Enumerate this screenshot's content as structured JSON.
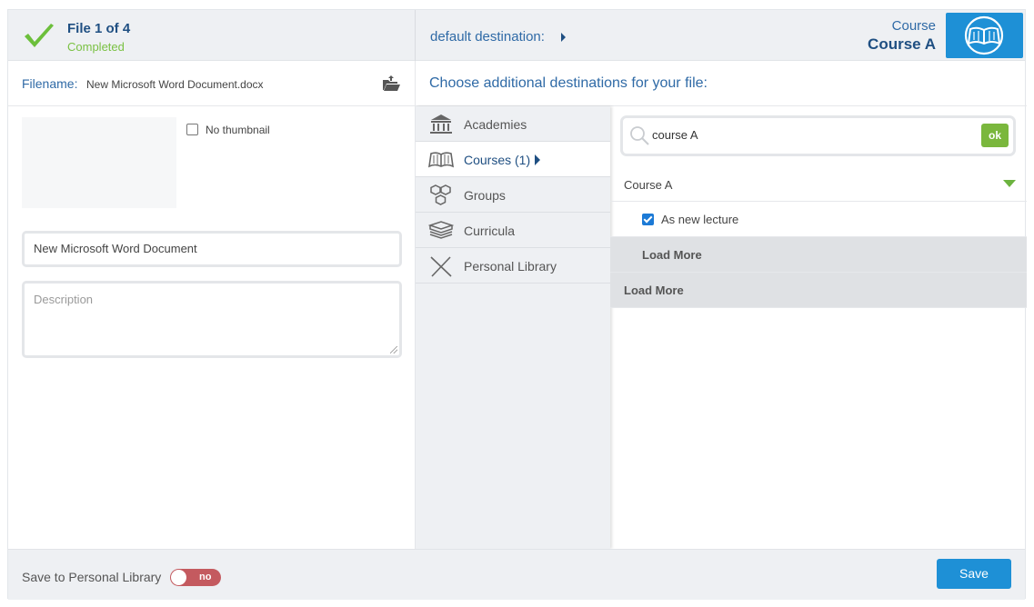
{
  "header": {
    "file_title": "File 1 of 4",
    "file_status": "Completed",
    "default_destination_label": "default destination:",
    "course_type": "Course",
    "course_name": "Course A",
    "icons": {
      "status": "checkmark-icon",
      "course": "open-book-icon"
    },
    "colors": {
      "status_green": "#7ac143",
      "accent_blue": "#1e90d6",
      "title_blue": "#1f4f82"
    }
  },
  "file": {
    "filename_label": "Filename:",
    "filename_value": "New Microsoft Word Document.docx",
    "no_thumbnail_label": "No thumbnail",
    "no_thumbnail_checked": false,
    "title_value": "New Microsoft Word Document",
    "description_placeholder": "Description"
  },
  "destinations": {
    "heading": "Choose additional destinations for your file:",
    "categories": [
      {
        "label": "Academies",
        "icon": "building-icon",
        "active": false
      },
      {
        "label": "Courses (1)",
        "icon": "book-icon",
        "active": true
      },
      {
        "label": "Groups",
        "icon": "hexagons-icon",
        "active": false
      },
      {
        "label": "Curricula",
        "icon": "stacked-books-icon",
        "active": false
      },
      {
        "label": "Personal Library",
        "icon": "crossed-lines-icon",
        "active": false
      }
    ],
    "search": {
      "value": "course A",
      "ok_label": "ok"
    },
    "results": [
      {
        "type": "course",
        "label": "Course A"
      },
      {
        "type": "option",
        "label": "As new lecture",
        "checked": true
      },
      {
        "type": "load_more",
        "label": "Load More"
      },
      {
        "type": "load_more",
        "label": "Load More"
      }
    ]
  },
  "footer": {
    "save_to_library_label": "Save to Personal Library",
    "toggle_text": "no",
    "toggle_on": false,
    "save_label": "Save",
    "colors": {
      "toggle_off": "#c45a5f",
      "save": "#1e90d6"
    }
  }
}
